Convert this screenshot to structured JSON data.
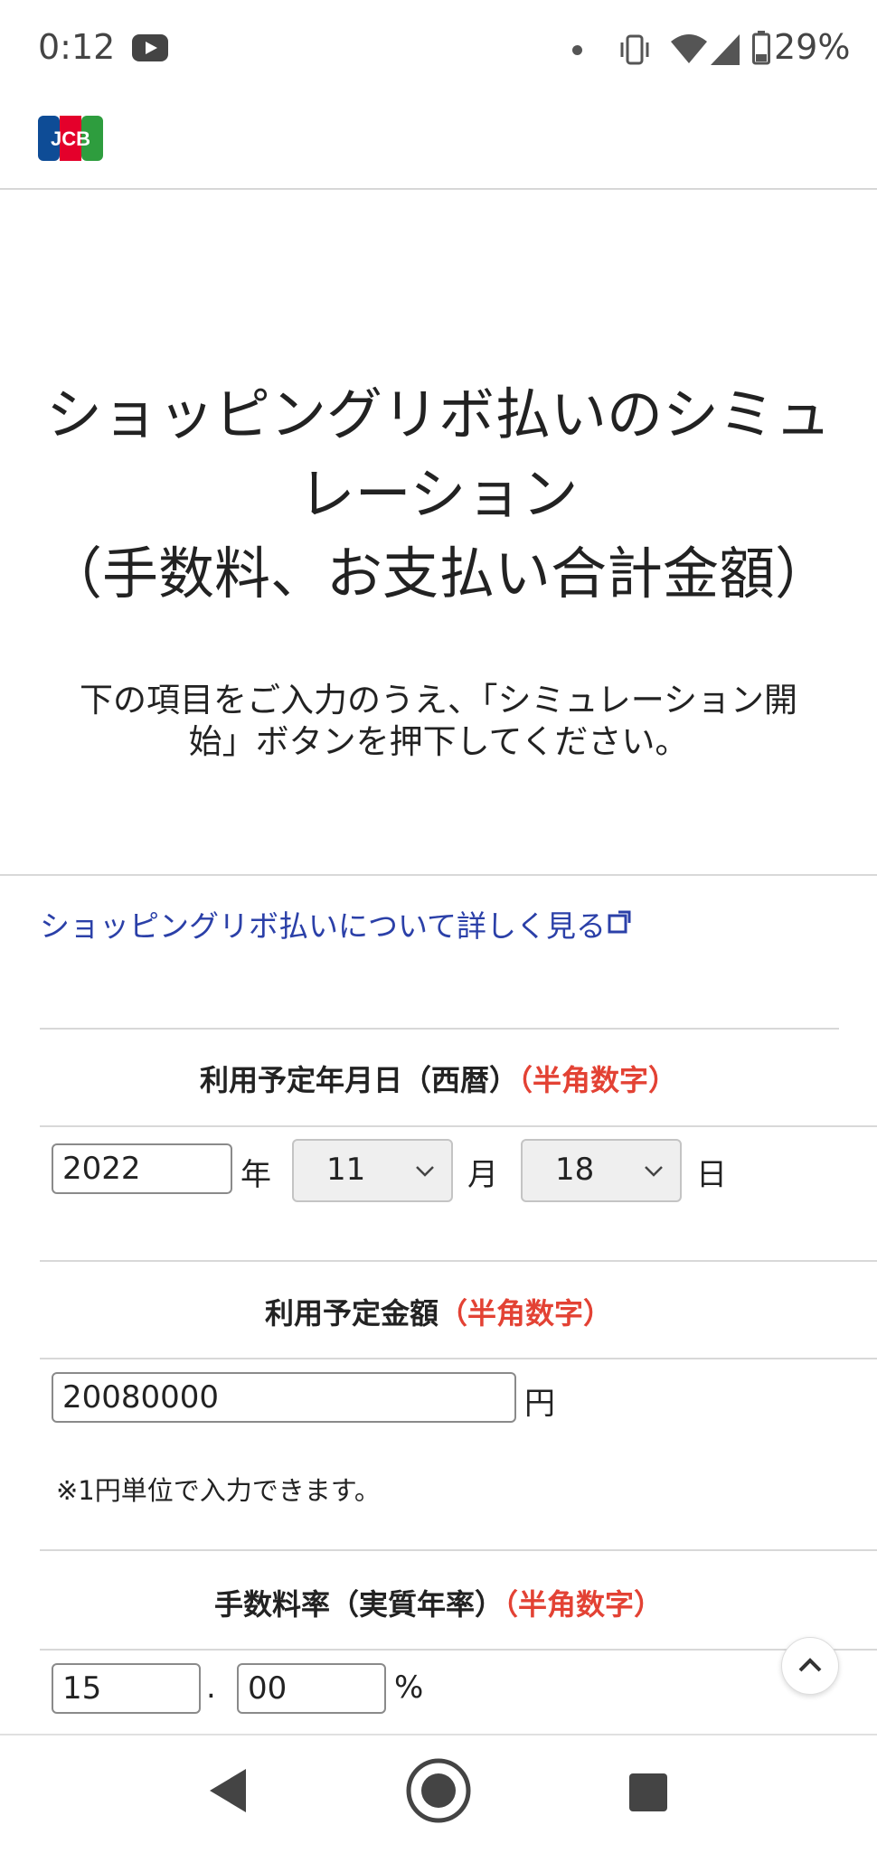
{
  "status_bar": {
    "time": "0:12",
    "battery": "29%"
  },
  "page": {
    "title_line1": "ショッピングリボ払いのシミュ",
    "title_line2": "レーション",
    "title_line3": "（手数料、お支払い合計金額）",
    "intro_line1": "下の項目をご入力のうえ、「シミュレーション開",
    "intro_line2": "始」ボタンを押下してください。",
    "learn_more_link": "ショッピングリボ払いについて詳しく見る"
  },
  "form": {
    "date": {
      "label": "利用予定年月日（西暦）",
      "hint": "（半角数字）",
      "year_value": "2022",
      "year_unit": "年",
      "month_value": "11",
      "month_unit": "月",
      "day_value": "18",
      "day_unit": "日"
    },
    "amount": {
      "label": "利用予定金額",
      "hint": "（半角数字）",
      "value": "20080000",
      "unit": "円",
      "note": "※1円単位で入力できます。"
    },
    "rate": {
      "label": "手数料率（実質年率）",
      "hint": "（半角数字）",
      "integer_value": "15",
      "dot": ".",
      "decimal_value": "00",
      "unit": "%"
    }
  },
  "icons": {
    "logo": "jcb-logo",
    "external": "external-link-icon",
    "scroll_top": "chevron-up-icon"
  },
  "colors": {
    "link": "#2b40a8",
    "hint": "#e34234"
  }
}
